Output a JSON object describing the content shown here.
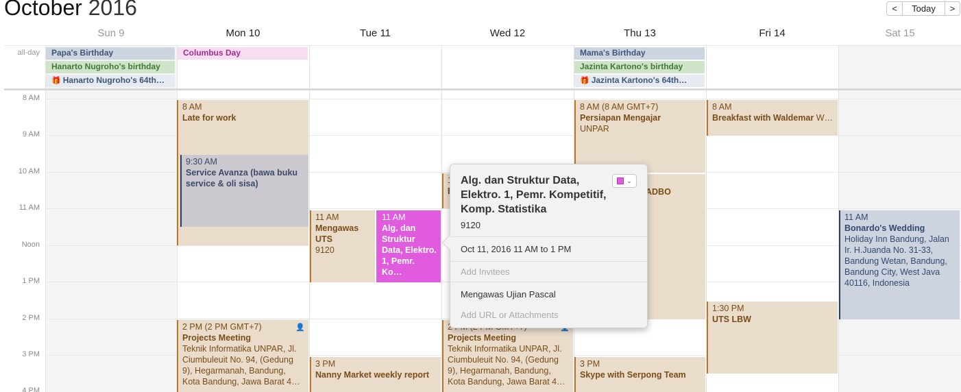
{
  "header": {
    "month": "October",
    "year": "2016",
    "prev_icon": "chevron-left-icon",
    "next_icon": "chevron-right-icon",
    "prev_glyph": "<",
    "next_glyph": ">",
    "today_label": "Today"
  },
  "days": [
    {
      "label": "Sun 9",
      "weekend": true
    },
    {
      "label": "Mon 10",
      "weekend": false
    },
    {
      "label": "Tue 11",
      "weekend": false
    },
    {
      "label": "Wed 12",
      "weekend": false
    },
    {
      "label": "Thu 13",
      "weekend": false
    },
    {
      "label": "Fri 14",
      "weekend": false
    },
    {
      "label": "Sat 15",
      "weekend": true
    }
  ],
  "all_day_label": "all-day",
  "all_day_events": [
    {
      "title": "Papa's Birthday",
      "color": "#cdd5e1"
    },
    {
      "title": "Hanarto Nugroho's birthday",
      "color": "#cfe3c8"
    },
    {
      "title": "Hanarto Nugroho's 64th…",
      "icon": "gift-icon",
      "glyph": "🎁"
    },
    {
      "title": "Columbus Day",
      "color": "#f8dcf1"
    },
    {
      "title": "Mama's Birthday",
      "color": "#cdd5e1"
    },
    {
      "title": "Jazinta Kartono's birthday",
      "color": "#cfe3c8"
    },
    {
      "title": "Jazinta Kartono's 64th…",
      "icon": "gift-icon",
      "glyph": "🎁"
    }
  ],
  "hours": [
    "8 AM",
    "9 AM",
    "10 AM",
    "11 AM",
    "Noon",
    "1 PM",
    "2 PM",
    "3 PM",
    "4 PM"
  ],
  "events": [
    {
      "time": "8 AM",
      "title": "Late for work"
    },
    {
      "time": "9:30 AM",
      "title": "Service Avanza (bawa buku service & oli sisa)"
    },
    {
      "time": "2 PM (2 PM GMT+7)",
      "title": "Projects Meeting",
      "location": "Teknik Informatika UNPAR, Jl. Ciumbuleuit No. 94, (Gedung 9), Hegarmanah, Bandung, Kota Bandung, Jawa Barat 4…",
      "icon": "meeting-icon",
      "glyph": "👤"
    },
    {
      "time": "11 AM",
      "title": "Mengawas UTS",
      "location": "9120"
    },
    {
      "time": "11 AM",
      "title": "Alg. dan Struktur Data, Elektro. 1, Pemr. Ko…",
      "color": "#e05bde"
    },
    {
      "time": "3 PM",
      "title": "Nanny Market weekly report"
    },
    {
      "time": "1",
      "title": "E"
    },
    {
      "time": "2 PM (2 PM GMT+7)",
      "title": "Projects Meeting",
      "location": "Teknik Informatika UNPAR, Jl. Ciumbuleuit No. 94, (Gedung 9), Hegarmanah, Bandung, Kota Bandung, Jawa Barat 4…",
      "icon": "meeting-icon",
      "glyph": "👤"
    },
    {
      "time": "8 AM (8 AM GMT+7)",
      "title": "Persiapan Mengajar",
      "location": "UNPAR"
    },
    {
      "title": "ADBO"
    },
    {
      "time": "3 PM",
      "title": "Skype with Serpong Team"
    },
    {
      "time": "8 AM",
      "title": "Breakfast with Waldemar",
      "extra": "W…"
    },
    {
      "time": "1:30 PM",
      "title": "UTS LBW"
    },
    {
      "time": "11 AM",
      "title": "Bonardo's Wedding",
      "location": "Holiday Inn Bandung, Jalan Ir. H.Juanda No. 31-33, Bandung Wetan, Bandung, Bandung City, West Java 40116, Indonesia"
    }
  ],
  "popover": {
    "title": "Alg. dan Struktur Data, Elektro. 1, Pemr. Kompetitif, Komp. Statistika",
    "location": "9120",
    "date_time": "Oct 11, 2016  11 AM to 1 PM",
    "invitees_placeholder": "Add Invitees",
    "notes": "Mengawas Ujian Pascal",
    "url_placeholder": "Add URL or Attachments",
    "calendar_color": "#e05bde",
    "chevron_icon": "chevron-down-icon",
    "chevron_glyph": "⌄"
  }
}
